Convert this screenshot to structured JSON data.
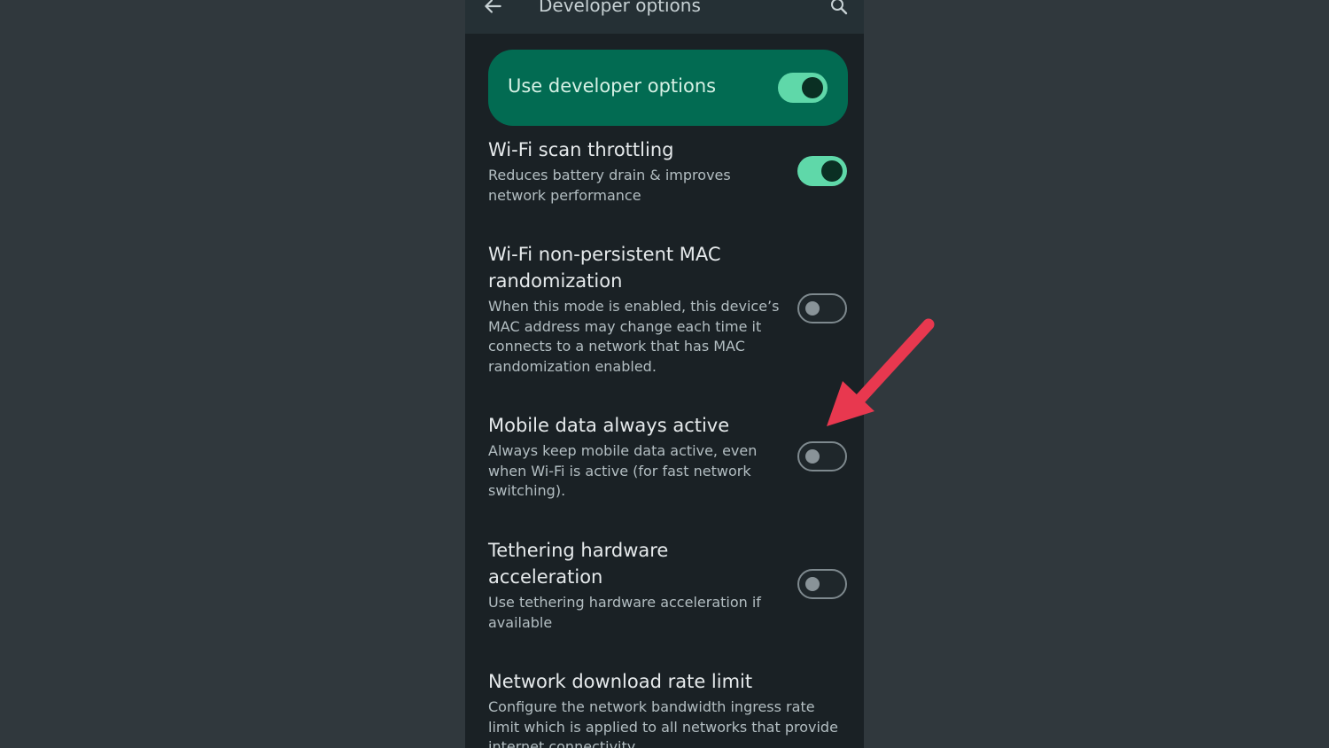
{
  "appbar": {
    "title": "Developer options",
    "back_icon": "arrow-left-icon",
    "search_icon": "search-icon"
  },
  "master_toggle": {
    "label": "Use developer options",
    "state": true
  },
  "settings": [
    {
      "title": "Wi-Fi scan throttling",
      "description": "Reduces battery drain & improves network performance",
      "state": true
    },
    {
      "title": "Wi-Fi non-persistent MAC randomization",
      "description": "When this mode is enabled, this device’s MAC address may change each time it connects to a network that has MAC randomization enabled.",
      "state": false
    },
    {
      "title": "Mobile data always active",
      "description": "Always keep mobile data active, even when Wi-Fi is active (for fast network switching).",
      "state": false
    },
    {
      "title": "Tethering hardware acceleration",
      "description": "Use tethering hardware acceleration if available",
      "state": false
    },
    {
      "title": "Network download rate limit",
      "description": "Configure the network bandwidth ingress rate limit which is applied to all networks that provide internet connectivity."
    }
  ],
  "colors": {
    "background": "#30383d",
    "screen": "#1a2125",
    "accent_card": "#026b52",
    "toggle_on": "#5fd8a9",
    "annotation_arrow": "#e8384f"
  }
}
